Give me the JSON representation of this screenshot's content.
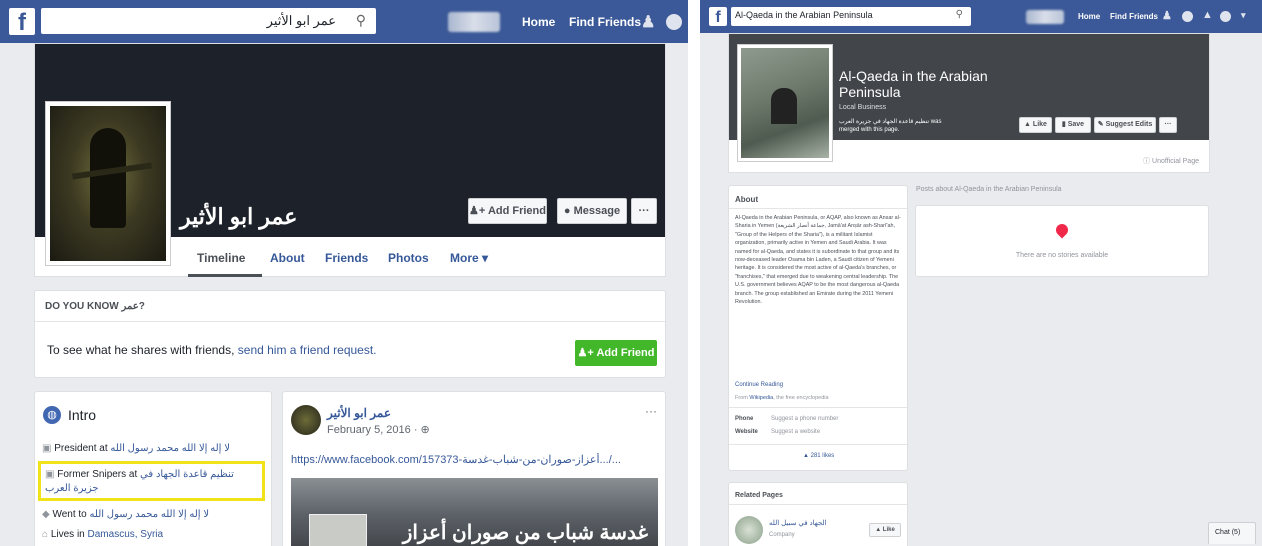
{
  "left": {
    "topbar": {
      "logo": "f",
      "search_value": "عمر ابو الأثير",
      "home": "Home",
      "find_friends": "Find Friends"
    },
    "profile": {
      "name": "عمر ابو الأثير",
      "add_friend": "Add Friend",
      "message": "Message",
      "more_dots": "···",
      "tabs": [
        "Timeline",
        "About",
        "Friends",
        "Photos",
        "More ▾"
      ]
    },
    "know": {
      "heading": "DO YOU KNOW عمر?",
      "text_prefix": "To see what he shares with friends, ",
      "link": "send him a friend request.",
      "button": "Add Friend"
    },
    "intro": {
      "title": "Intro",
      "items": [
        {
          "prefix": "President at ",
          "link": "لا إله إلا الله محمد رسول الله"
        },
        {
          "prefix": "Former Snipers at ",
          "link": "تنظيم قاعدة الجهاد في جزيرة العرب"
        },
        {
          "prefix": "Went to ",
          "link": "لا إله إلا الله محمد رسول الله"
        },
        {
          "prefix": "Lives in ",
          "link": "Damascus, Syria"
        }
      ]
    },
    "post": {
      "author": "عمر ابو الأثير",
      "date": "February 5, 2016 · ⊕",
      "menu": "···",
      "url": "https://www.facebook.com/157373-أعزاز-صوران-من-شباب-غدسة.../...",
      "image_caption": "غدسة شباب من صوران أعزاز"
    }
  },
  "right": {
    "topbar": {
      "logo": "f",
      "search_value": "Al-Qaeda in the Arabian Peninsula",
      "home": "Home",
      "find_friends": "Find Friends"
    },
    "page": {
      "title": "Al-Qaeda in the Arabian Peninsula",
      "category": "Local Business",
      "merged_text": "تنظيم قاعدة الجهاد في جزيرة العرب was merged with this page.",
      "like": "Like",
      "save": "Save",
      "suggest_edits": "Suggest Edits",
      "more_dots": "···",
      "unofficial": "Unofficial Page"
    },
    "about": {
      "heading": "About",
      "body": "Al-Qaeda in the Arabian Peninsula, or AQAP, also known as Ansar al-Sharia in Yemen (جماعة أنصار الشريعة, Jamā'at Anṣār ash-Sharī'ah, \"Group of the Helpers of the Sharia\"), is a militant Islamist organization, primarily active in Yemen and Saudi Arabia. It was named for al-Qaeda, and states it is subordinate to that group and its now-deceased leader Osama bin Laden, a Saudi citizen of Yemeni heritage. It is considered the most active of al-Qaeda's branches, or \"franchises,\" that emerged due to weakening central leadership. The U.S. government believes AQAP to be the most dangerous al-Qaeda branch. The group established an Emirate during the 2011 Yemeni Revolution.",
      "continue": "Continue Reading",
      "from_prefix": "From ",
      "from_link": "Wikipedia",
      "from_suffix": ", the free encyclopedia",
      "phone_label": "Phone",
      "phone_value": "Suggest a phone number",
      "website_label": "Website",
      "website_value": "Suggest a website",
      "likes": "281 likes"
    },
    "posts_about": {
      "heading": "Posts about Al-Qaeda in the Arabian Peninsula",
      "empty": "There are no stories available"
    },
    "related": {
      "heading": "Related Pages",
      "item_name": "الجهاد في سبيل الله",
      "item_category": "Company",
      "like": "Like"
    },
    "chat": "Chat (5)"
  },
  "colors": {
    "fb_blue": "#3b5998",
    "link": "#365899",
    "green": "#42b72a",
    "highlight": "#f0e31a",
    "pin": "#f02849"
  }
}
